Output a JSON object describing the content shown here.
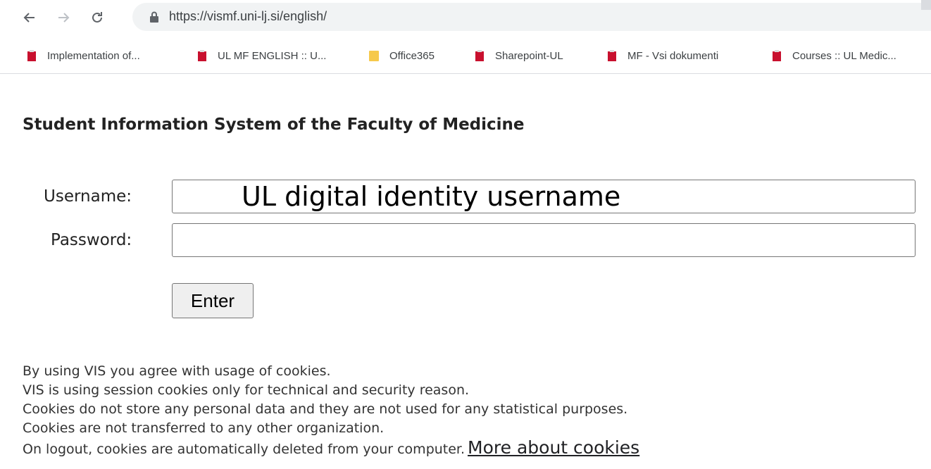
{
  "browser": {
    "url": "https://vismf.uni-lj.si/english/",
    "bookmarks": [
      {
        "label": "Implementation of...",
        "icon": "red-bookmark-icon"
      },
      {
        "label": "UL MF ENGLISH :: U...",
        "icon": "red-bookmark-icon"
      },
      {
        "label": "Office365",
        "icon": "folder-icon"
      },
      {
        "label": "Sharepoint-UL",
        "icon": "red-bookmark-icon"
      },
      {
        "label": "MF - Vsi dokumenti",
        "icon": "red-bookmark-icon"
      },
      {
        "label": "Courses :: UL Medic...",
        "icon": "red-bookmark-icon"
      }
    ]
  },
  "page": {
    "title": "Student Information System of the Faculty of Medicine",
    "username_label": "Username:",
    "username_placeholder": "UL digital identity username",
    "password_label": "Password:",
    "enter_label": "Enter",
    "notice": [
      "By using VIS you agree with usage of cookies.",
      "VIS is using session cookies only for technical and security reason.",
      "Cookies do not store any personal data and they are not used for any statistical purposes.",
      "Cookies are not transferred to any other organization.",
      "On logout, cookies are automatically deleted from your computer."
    ],
    "cookies_link": "More about cookies"
  },
  "colors": {
    "omnibox_bg": "#f1f3f4",
    "favicon_red": "#c8102e",
    "folder_yellow": "#f6c94b"
  }
}
